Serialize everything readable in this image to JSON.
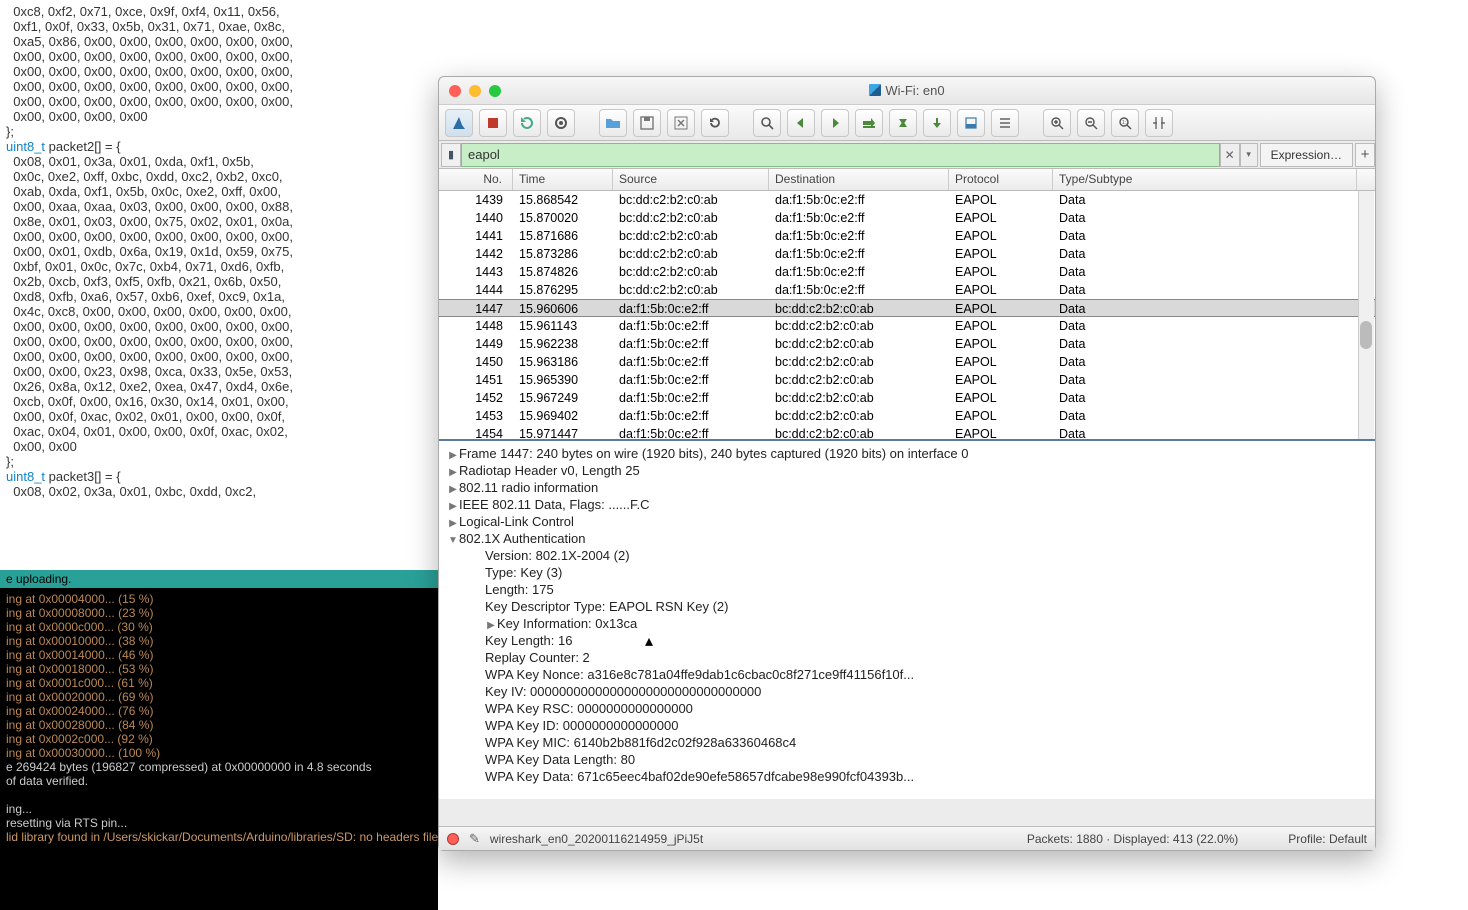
{
  "code_pane": {
    "block1": "  0xc8, 0xf2, 0x71, 0xce, 0x9f, 0xf4, 0x11, 0x56,\n  0xf1, 0x0f, 0x33, 0x5b, 0x31, 0x71, 0xae, 0x8c,\n  0xa5, 0x86, 0x00, 0x00, 0x00, 0x00, 0x00, 0x00,\n  0x00, 0x00, 0x00, 0x00, 0x00, 0x00, 0x00, 0x00,\n  0x00, 0x00, 0x00, 0x00, 0x00, 0x00, 0x00, 0x00,\n  0x00, 0x00, 0x00, 0x00, 0x00, 0x00, 0x00, 0x00,\n  0x00, 0x00, 0x00, 0x00, 0x00, 0x00, 0x00, 0x00,\n  0x00, 0x00, 0x00, 0x00\n};",
    "decl2_kw": "uint8_t",
    "decl2_rest": " packet2[] = {",
    "block2": "  0x08, 0x01, 0x3a, 0x01, 0xda, 0xf1, 0x5b,\n  0x0c, 0xe2, 0xff, 0xbc, 0xdd, 0xc2, 0xb2, 0xc0,\n  0xab, 0xda, 0xf1, 0x5b, 0x0c, 0xe2, 0xff, 0x00,\n  0x00, 0xaa, 0xaa, 0x03, 0x00, 0x00, 0x00, 0x88,\n  0x8e, 0x01, 0x03, 0x00, 0x75, 0x02, 0x01, 0x0a,\n  0x00, 0x00, 0x00, 0x00, 0x00, 0x00, 0x00, 0x00,\n  0x00, 0x01, 0xdb, 0x6a, 0x19, 0x1d, 0x59, 0x75,\n  0xbf, 0x01, 0x0c, 0x7c, 0xb4, 0x71, 0xd6, 0xfb,\n  0x2b, 0xcb, 0xf3, 0xf5, 0xfb, 0x21, 0x6b, 0x50,\n  0xd8, 0xfb, 0xa6, 0x57, 0xb6, 0xef, 0xc9, 0x1a,\n  0x4c, 0xc8, 0x00, 0x00, 0x00, 0x00, 0x00, 0x00,\n  0x00, 0x00, 0x00, 0x00, 0x00, 0x00, 0x00, 0x00,\n  0x00, 0x00, 0x00, 0x00, 0x00, 0x00, 0x00, 0x00,\n  0x00, 0x00, 0x00, 0x00, 0x00, 0x00, 0x00, 0x00,\n  0x00, 0x00, 0x23, 0x98, 0xca, 0x33, 0x5e, 0x53,\n  0x26, 0x8a, 0x12, 0xe2, 0xea, 0x47, 0xd4, 0x6e,\n  0xcb, 0x0f, 0x00, 0x16, 0x30, 0x14, 0x01, 0x00,\n  0x00, 0x0f, 0xac, 0x02, 0x01, 0x00, 0x00, 0x0f,\n  0xac, 0x04, 0x01, 0x00, 0x00, 0x0f, 0xac, 0x02,\n  0x00, 0x00\n};",
    "decl3_kw": "uint8_t",
    "decl3_rest": " packet3[] = {",
    "block3": "  0x08, 0x02, 0x3a, 0x01, 0xbc, 0xdd, 0xc2,"
  },
  "terminal": {
    "banner": "e uploading.",
    "lines": [
      "ing at 0x00004000... (15 %)",
      "ing at 0x00008000... (23 %)",
      "ing at 0x0000c000... (30 %)",
      "ing at 0x00010000... (38 %)",
      "ing at 0x00014000... (46 %)",
      "ing at 0x00018000... (53 %)",
      "ing at 0x0001c000... (61 %)",
      "ing at 0x00020000... (69 %)",
      "ing at 0x00024000... (76 %)",
      "ing at 0x00028000... (84 %)",
      "ing at 0x0002c000... (92 %)",
      "ing at 0x00030000... (100 %)"
    ],
    "wrote": "e 269424 bytes (196827 compressed) at 0x00000000 in 4.8 seconds",
    "verified": " of data verified.",
    "blank": "",
    "leaving": "ing...",
    "reset": " resetting via RTS pin...",
    "footer": "lid library found in /Users/skickar/Documents/Arduino/libraries/SD: no headers files (.h) found in /Users/skickar/Documents/Arduino/libraries/SD/src"
  },
  "ws": {
    "title": "Wi-Fi: en0",
    "filter": {
      "value": "eapol",
      "expr_label": "Expression…",
      "plus": "+"
    },
    "columns": {
      "no": "No.",
      "time": "Time",
      "source": "Source",
      "dest": "Destination",
      "protocol": "Protocol",
      "type": "Type/Subtype"
    },
    "packets": [
      {
        "no": "1439",
        "time": "15.868542",
        "src": "bc:dd:c2:b2:c0:ab",
        "dst": "da:f1:5b:0c:e2:ff",
        "prot": "EAPOL",
        "typ": "Data"
      },
      {
        "no": "1440",
        "time": "15.870020",
        "src": "bc:dd:c2:b2:c0:ab",
        "dst": "da:f1:5b:0c:e2:ff",
        "prot": "EAPOL",
        "typ": "Data"
      },
      {
        "no": "1441",
        "time": "15.871686",
        "src": "bc:dd:c2:b2:c0:ab",
        "dst": "da:f1:5b:0c:e2:ff",
        "prot": "EAPOL",
        "typ": "Data"
      },
      {
        "no": "1442",
        "time": "15.873286",
        "src": "bc:dd:c2:b2:c0:ab",
        "dst": "da:f1:5b:0c:e2:ff",
        "prot": "EAPOL",
        "typ": "Data"
      },
      {
        "no": "1443",
        "time": "15.874826",
        "src": "bc:dd:c2:b2:c0:ab",
        "dst": "da:f1:5b:0c:e2:ff",
        "prot": "EAPOL",
        "typ": "Data"
      },
      {
        "no": "1444",
        "time": "15.876295",
        "src": "bc:dd:c2:b2:c0:ab",
        "dst": "da:f1:5b:0c:e2:ff",
        "prot": "EAPOL",
        "typ": "Data"
      },
      {
        "no": "1447",
        "time": "15.960606",
        "src": "da:f1:5b:0c:e2:ff",
        "dst": "bc:dd:c2:b2:c0:ab",
        "prot": "EAPOL",
        "typ": "Data",
        "sel": true
      },
      {
        "no": "1448",
        "time": "15.961143",
        "src": "da:f1:5b:0c:e2:ff",
        "dst": "bc:dd:c2:b2:c0:ab",
        "prot": "EAPOL",
        "typ": "Data"
      },
      {
        "no": "1449",
        "time": "15.962238",
        "src": "da:f1:5b:0c:e2:ff",
        "dst": "bc:dd:c2:b2:c0:ab",
        "prot": "EAPOL",
        "typ": "Data"
      },
      {
        "no": "1450",
        "time": "15.963186",
        "src": "da:f1:5b:0c:e2:ff",
        "dst": "bc:dd:c2:b2:c0:ab",
        "prot": "EAPOL",
        "typ": "Data"
      },
      {
        "no": "1451",
        "time": "15.965390",
        "src": "da:f1:5b:0c:e2:ff",
        "dst": "bc:dd:c2:b2:c0:ab",
        "prot": "EAPOL",
        "typ": "Data"
      },
      {
        "no": "1452",
        "time": "15.967249",
        "src": "da:f1:5b:0c:e2:ff",
        "dst": "bc:dd:c2:b2:c0:ab",
        "prot": "EAPOL",
        "typ": "Data"
      },
      {
        "no": "1453",
        "time": "15.969402",
        "src": "da:f1:5b:0c:e2:ff",
        "dst": "bc:dd:c2:b2:c0:ab",
        "prot": "EAPOL",
        "typ": "Data"
      },
      {
        "no": "1454",
        "time": "15.971447",
        "src": "da:f1:5b:0c:e2:ff",
        "dst": "bc:dd:c2:b2:c0:ab",
        "prot": "EAPOL",
        "typ": "Data"
      }
    ],
    "detail": {
      "top": [
        {
          "arrow": "▶",
          "text": "Frame 1447: 240 bytes on wire (1920 bits), 240 bytes captured (1920 bits) on interface 0"
        },
        {
          "arrow": "▶",
          "text": "Radiotap Header v0, Length 25"
        },
        {
          "arrow": "▶",
          "text": "802.11 radio information"
        },
        {
          "arrow": "▶",
          "text": "IEEE 802.11 Data, Flags: ......F.C"
        },
        {
          "arrow": "▶",
          "text": "Logical-Link Control"
        },
        {
          "arrow": "▼",
          "text": "802.1X Authentication"
        }
      ],
      "auth": [
        "Version: 802.1X-2004 (2)",
        "Type: Key (3)",
        "Length: 175",
        "Key Descriptor Type: EAPOL RSN Key (2)"
      ],
      "keyinfo_arrow": "▶",
      "keyinfo": "Key Information: 0x13ca",
      "auth2": [
        "Key Length: 16",
        "Replay Counter: 2",
        "WPA Key Nonce: a316e8c781a04ffe9dab1c6cbac0c8f271ce9ff41156f10f...",
        "Key IV: 00000000000000000000000000000000",
        "WPA Key RSC: 0000000000000000",
        "WPA Key ID: 0000000000000000",
        "WPA Key MIC: 6140b2b881f6d2c02f928a63360468c4",
        "WPA Key Data Length: 80",
        "WPA Key Data: 671c65eec4baf02de90efe58657dfcabe98e990fcf04393b..."
      ]
    },
    "status": {
      "file": "wireshark_en0_20200116214959_jPiJ5t",
      "packets": "Packets: 1880 · Displayed: 413 (22.0%)",
      "profile": "Profile: Default"
    }
  }
}
